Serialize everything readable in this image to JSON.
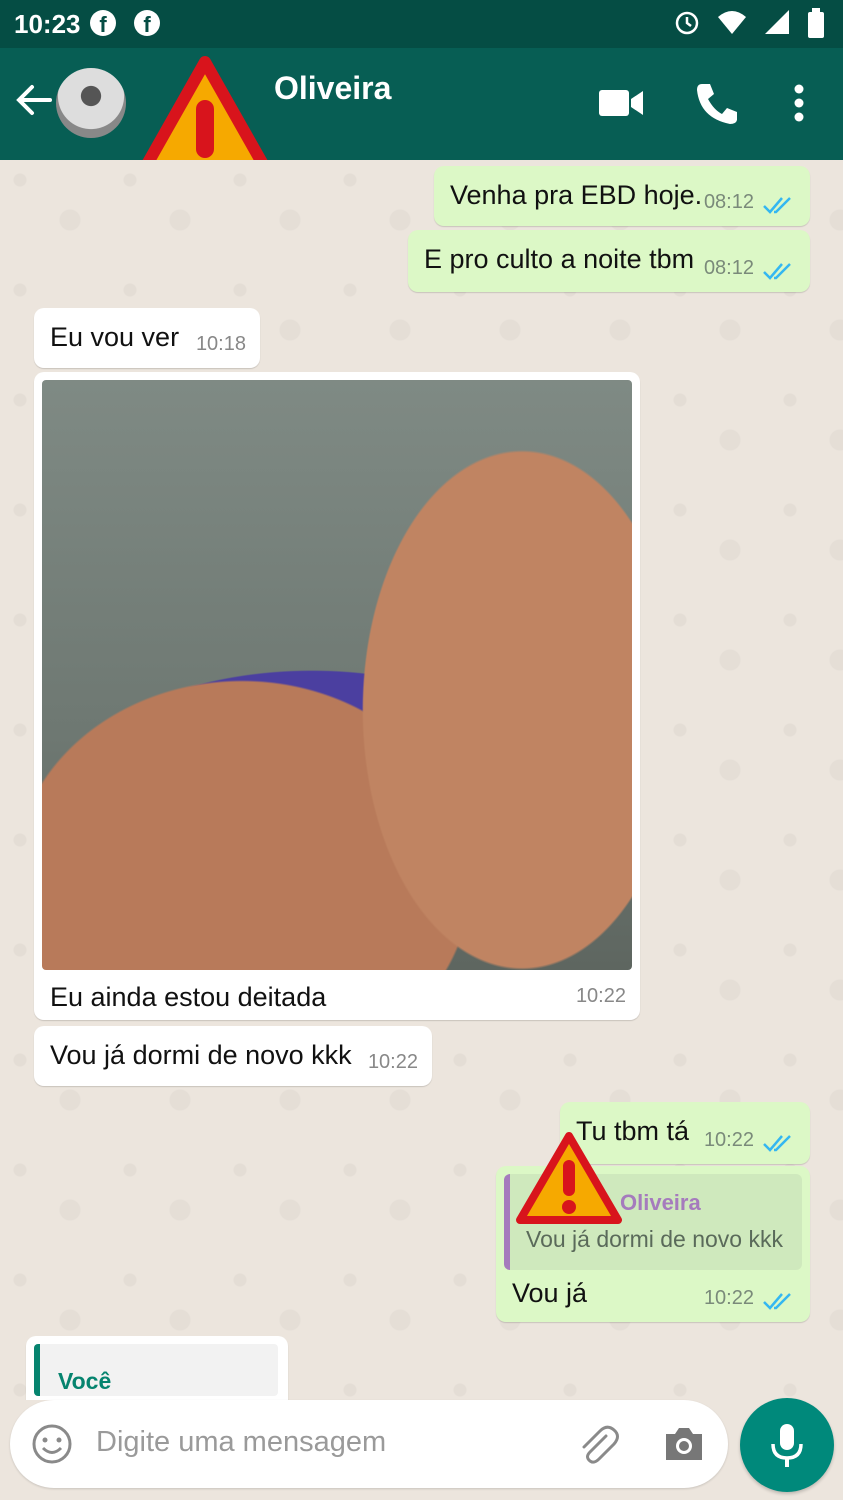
{
  "status_bar": {
    "time": "10:23"
  },
  "header": {
    "contact_name": "Oliveira"
  },
  "messages": [
    {
      "dir": "out",
      "text": "Venha pra EBD hoje.",
      "time": "08:12"
    },
    {
      "dir": "out",
      "text": "E pro culto a noite tbm",
      "time": "08:12"
    },
    {
      "dir": "in",
      "text": "Eu vou ver",
      "time": "10:18"
    },
    {
      "dir": "in",
      "type": "image",
      "caption": "Eu ainda estou deitada",
      "time": "10:22"
    },
    {
      "dir": "in",
      "text": "Vou já dormi de novo kkk",
      "time": "10:22"
    },
    {
      "dir": "out",
      "text": "Tu tbm tá",
      "time": "10:22"
    },
    {
      "dir": "out",
      "text": "Vou já",
      "time": "10:22",
      "reply_to": {
        "name": "Oliveira",
        "text": "Vou já dormi de novo kkk"
      }
    },
    {
      "dir": "in",
      "reply_to": {
        "name": "Você"
      }
    }
  ],
  "input": {
    "placeholder": "Digite uma mensagem"
  },
  "colors": {
    "header": "#075e54",
    "status": "#054d44",
    "outgoing": "#dcf8c6",
    "incoming": "#ffffff",
    "accent": "#00897b",
    "read_ticks": "#34b7f1"
  },
  "icons": [
    "back-arrow-icon",
    "facebook-icon",
    "alarm-icon",
    "wifi-icon",
    "signal-icon",
    "battery-icon",
    "warning-icon",
    "video-call-icon",
    "phone-icon",
    "more-options-icon",
    "read-ticks-icon",
    "emoji-icon",
    "attach-icon",
    "camera-icon",
    "mic-icon"
  ]
}
